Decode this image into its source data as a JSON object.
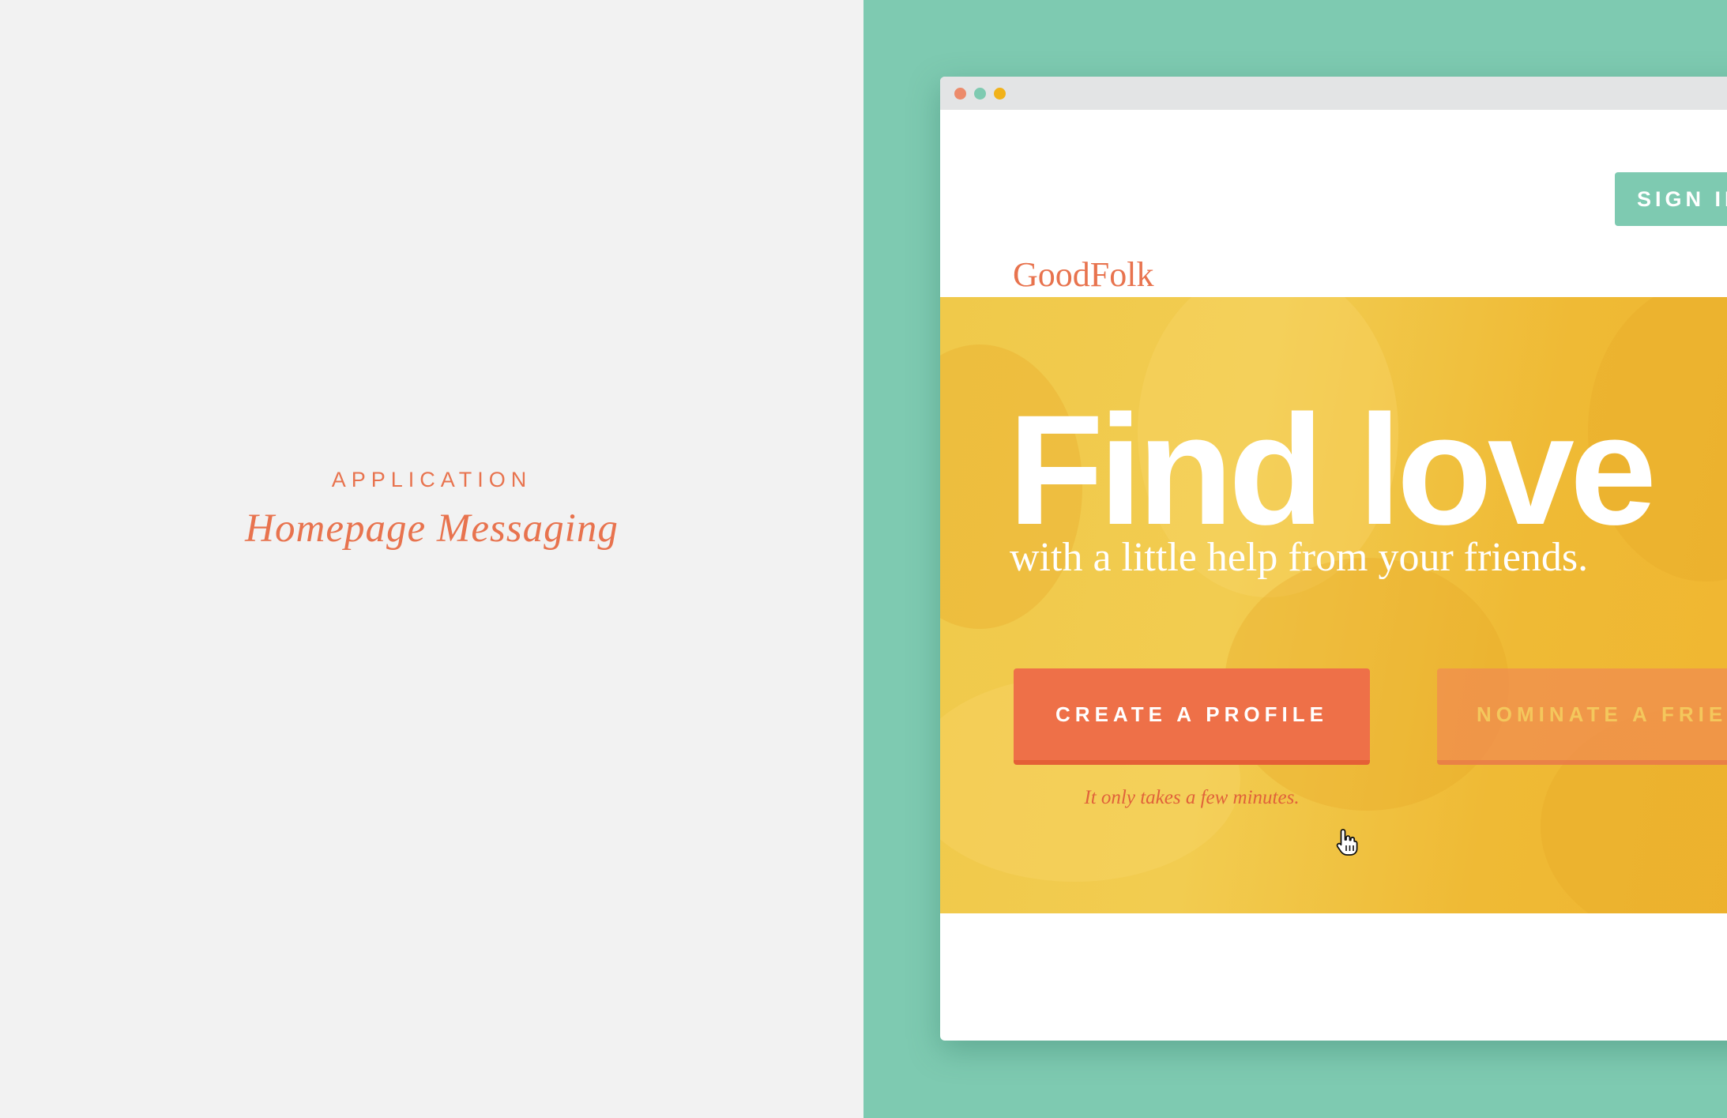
{
  "caption": {
    "eyebrow": "APPLICATION",
    "title": "Homepage Messaging"
  },
  "browser": {
    "dots": [
      "red-dot",
      "green-dot",
      "yellow-dot"
    ]
  },
  "header": {
    "logo": "GoodFolk",
    "signin_label": "SIGN IN"
  },
  "hero": {
    "headline": "Find love",
    "subheadline": "with a little help from your friends.",
    "primary_button": "CREATE A PROFILE",
    "secondary_button": "NOMINATE A FRIEND",
    "note": "It only takes a few minutes."
  },
  "colors": {
    "accent": "#e8734e",
    "teal": "#7ecab1",
    "hero_yellow": "#f0c94a",
    "button_orange": "#ee7048"
  },
  "icons": {
    "cursor": "hand-pointer-icon"
  }
}
